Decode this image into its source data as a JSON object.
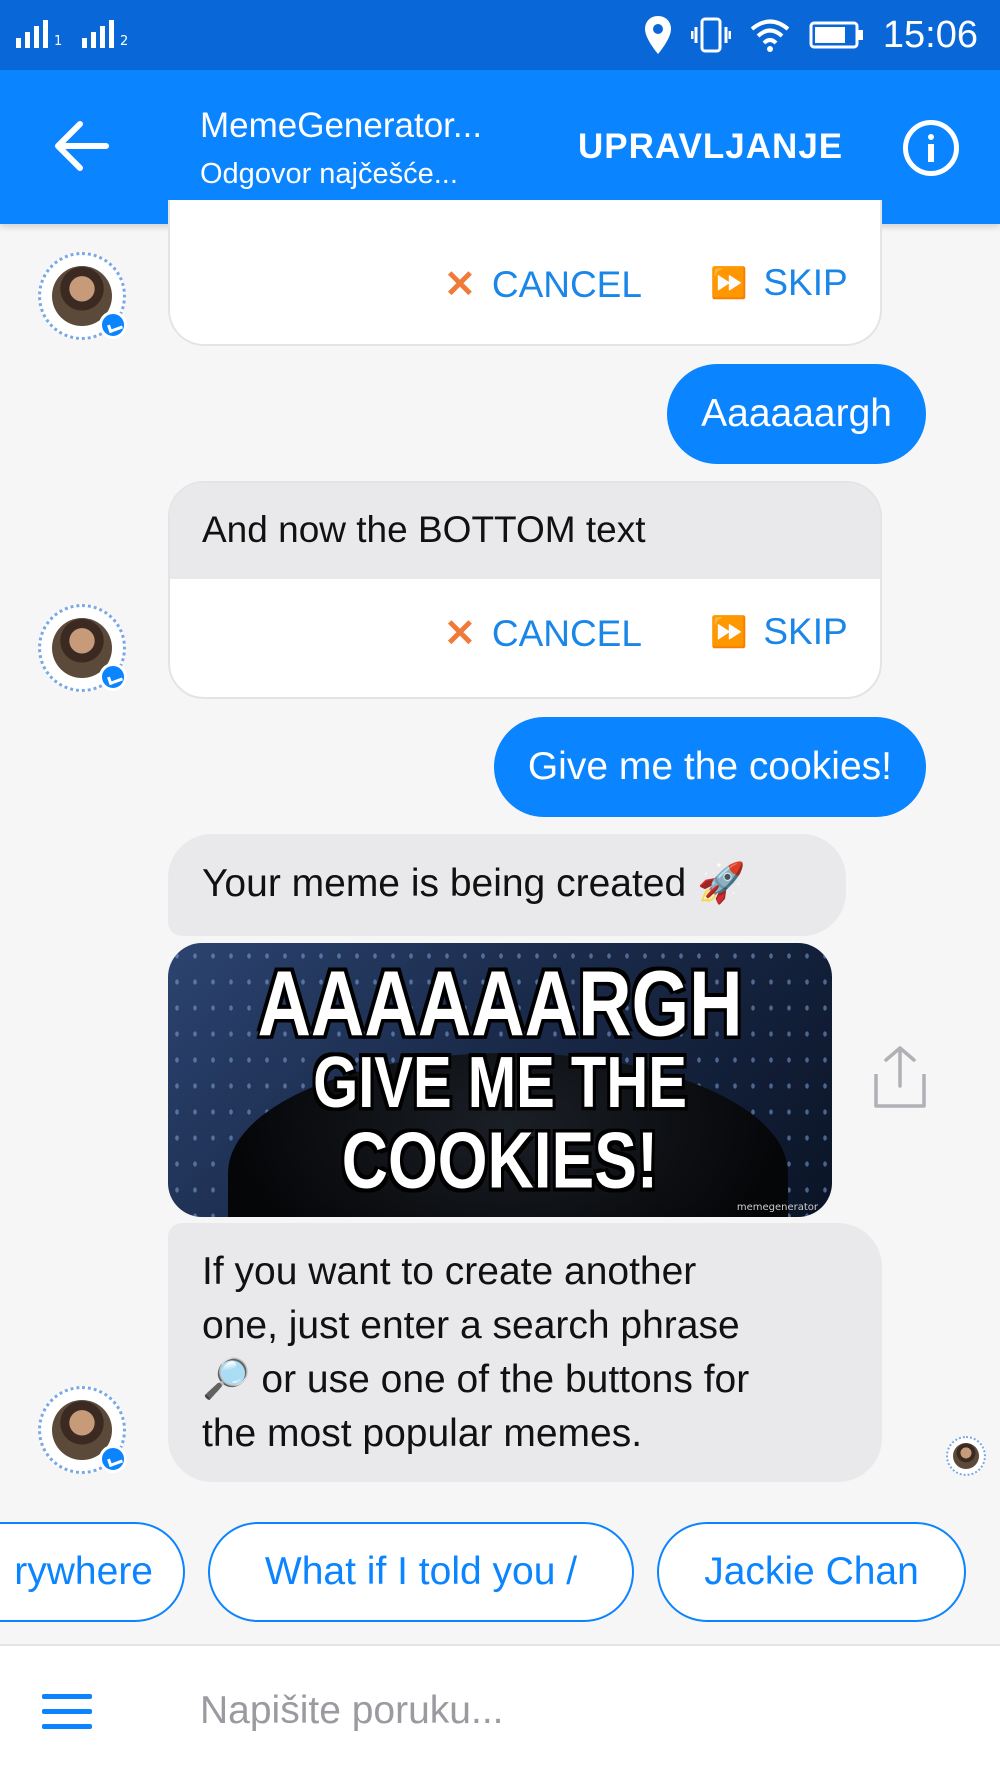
{
  "status_bar": {
    "sim1": "1",
    "sim2": "2",
    "time": "15:06"
  },
  "header": {
    "title": "MemeGenerator...",
    "subtitle": "Odgovor najčešće...",
    "manage_label": "UPRAVLJANJE"
  },
  "messages": {
    "card1": {
      "cancel_label": "CANCEL",
      "skip_label": "SKIP"
    },
    "user_msg1": "Aaaaaargh",
    "card2": {
      "prompt": "And now the BOTTOM text",
      "cancel_label": "CANCEL",
      "skip_label": "SKIP"
    },
    "user_msg2": "Give me the cookies!",
    "bot_msg1": {
      "text": "Your meme is being created",
      "emoji": "🚀"
    },
    "meme": {
      "top_text": "AAAAAARGH",
      "bottom_line1": "GIVE ME THE",
      "bottom_line2": "COOKIES!",
      "watermark": "memegenerator"
    },
    "bot_msg2": {
      "line1": "If you want to create another",
      "line2": "one, just enter a search phrase",
      "emoji": "🔎",
      "line3": " or use one of the buttons for",
      "line4": "the most popular memes."
    }
  },
  "quick_replies": [
    "rywhere",
    "What if I told you /",
    "Jackie Chan"
  ],
  "composer": {
    "placeholder": "Napišite poruku..."
  },
  "colors": {
    "status_bar": "#0a67d8",
    "header": "#0a84ff",
    "accent": "#0a84ff",
    "cancel_icon": "#f07a3a",
    "skip_icon": "#3aa5f0",
    "incoming_bubble": "#e9e9eb"
  },
  "icons": {
    "back": "arrow-left-icon",
    "info": "info-circle-icon",
    "cancel": "x-icon",
    "skip": "fast-forward-icon",
    "share": "share-icon",
    "menu": "hamburger-menu-icon"
  }
}
